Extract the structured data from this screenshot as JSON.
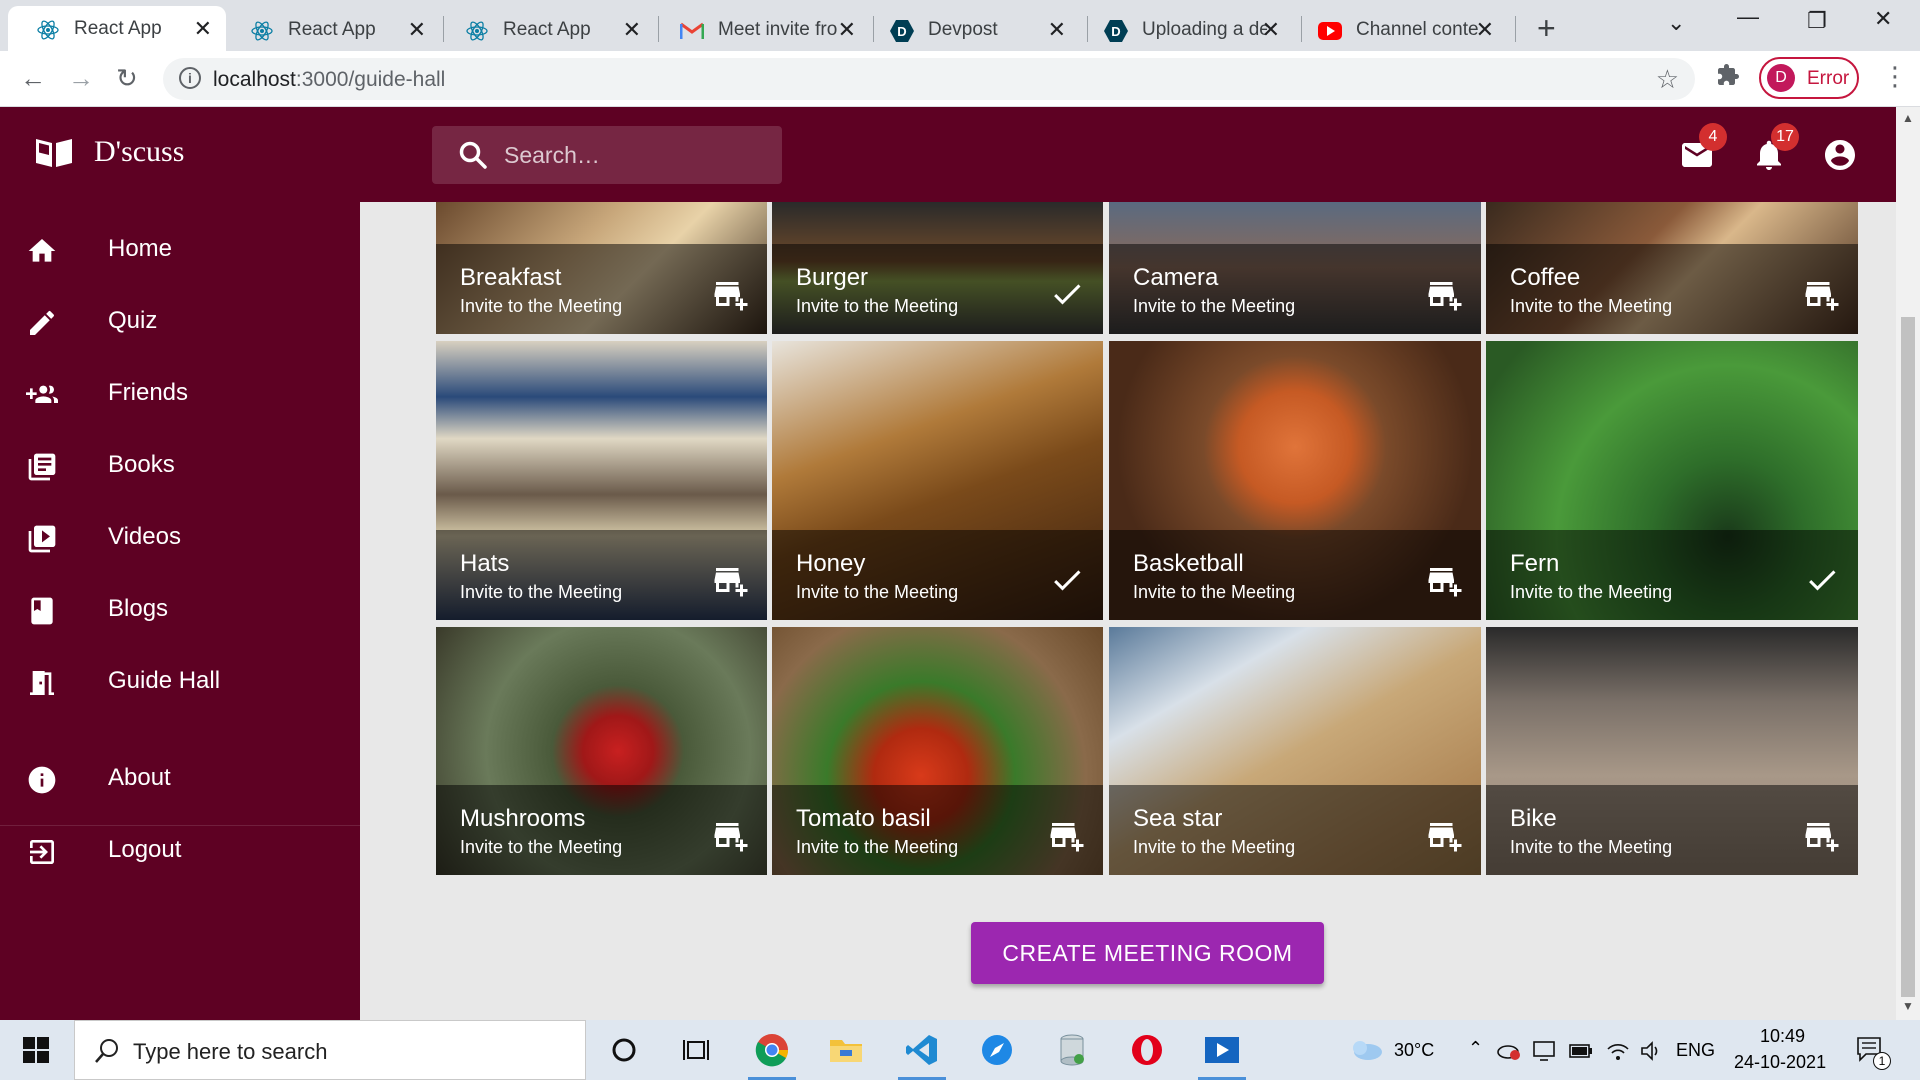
{
  "browser": {
    "tabs": [
      {
        "label": "React App",
        "favicon": "react-icon"
      },
      {
        "label": "React App",
        "favicon": "react-icon"
      },
      {
        "label": "React App",
        "favicon": "react-icon"
      },
      {
        "label": "Meet invite fro",
        "favicon": "gmail-icon"
      },
      {
        "label": "Devpost",
        "favicon": "devpost-icon"
      },
      {
        "label": "Uploading a de",
        "favicon": "devpost-icon"
      },
      {
        "label": "Channel conte",
        "favicon": "youtube-icon"
      }
    ],
    "url_host": "localhost",
    "url_path": ":3000/guide-hall",
    "profile_initial": "D",
    "profile_status": "Error"
  },
  "app": {
    "brand": "D'scuss",
    "search_placeholder": "Search…",
    "mail_count": "4",
    "notification_count": "17",
    "colors": {
      "primary": "#5e0123",
      "accent": "#9c27b0"
    },
    "nav": [
      {
        "label": "Home",
        "icon": "home-icon"
      },
      {
        "label": "Quiz",
        "icon": "pencil-icon"
      },
      {
        "label": "Friends",
        "icon": "group-add-icon"
      },
      {
        "label": "Books",
        "icon": "library-books-icon"
      },
      {
        "label": "Videos",
        "icon": "video-library-icon"
      },
      {
        "label": "Blogs",
        "icon": "book-icon"
      },
      {
        "label": "Guide Hall",
        "icon": "meeting-room-icon"
      },
      {
        "label": "About",
        "icon": "info-icon"
      },
      {
        "label": "Logout",
        "icon": "logout-icon"
      }
    ],
    "tiles": [
      {
        "title": "Breakfast",
        "subtitle": "Invite to the Meeting",
        "state": "add"
      },
      {
        "title": "Burger",
        "subtitle": "Invite to the Meeting",
        "state": "check"
      },
      {
        "title": "Camera",
        "subtitle": "Invite to the Meeting",
        "state": "add"
      },
      {
        "title": "Coffee",
        "subtitle": "Invite to the Meeting",
        "state": "add"
      },
      {
        "title": "Hats",
        "subtitle": "Invite to the Meeting",
        "state": "add"
      },
      {
        "title": "Honey",
        "subtitle": "Invite to the Meeting",
        "state": "check"
      },
      {
        "title": "Basketball",
        "subtitle": "Invite to the Meeting",
        "state": "add"
      },
      {
        "title": "Fern",
        "subtitle": "Invite to the Meeting",
        "state": "check"
      },
      {
        "title": "Mushrooms",
        "subtitle": "Invite to the Meeting",
        "state": "add"
      },
      {
        "title": "Tomato basil",
        "subtitle": "Invite to the Meeting",
        "state": "add"
      },
      {
        "title": "Sea star",
        "subtitle": "Invite to the Meeting",
        "state": "add"
      },
      {
        "title": "Bike",
        "subtitle": "Invite to the Meeting",
        "state": "add"
      }
    ],
    "cta_label": "CREATE MEETING ROOM"
  },
  "taskbar": {
    "search_placeholder": "Type here to search",
    "temperature": "30°C",
    "language": "ENG",
    "time": "10:49",
    "date": "24-10-2021",
    "notification_count": "1"
  }
}
